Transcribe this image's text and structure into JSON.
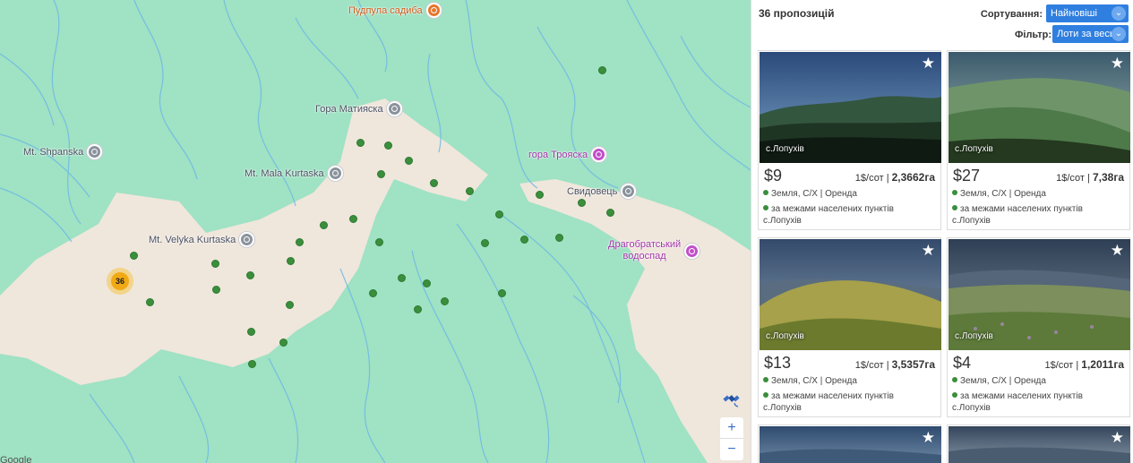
{
  "map": {
    "pois": [
      {
        "id": "pudpula",
        "label": "Пудпула садиба",
        "kind": "restaurant"
      },
      {
        "id": "matyaska",
        "label": "Гора Матияска",
        "kind": "peak"
      },
      {
        "id": "shpanska",
        "label": "Mt. Shpanska",
        "kind": "peak"
      },
      {
        "id": "mala",
        "label": "Mt. Mala Kurtaska",
        "kind": "peak"
      },
      {
        "id": "troyaska",
        "label": "гора Трояска",
        "kind": "attraction"
      },
      {
        "id": "svydovets",
        "label": "Свидовець",
        "kind": "peak"
      },
      {
        "id": "velyka",
        "label": "Mt. Velyka Kurtaska",
        "kind": "peak"
      },
      {
        "id": "vodospad_1",
        "label": "Драгобратський",
        "kind": "attraction"
      },
      {
        "id": "vodospad_2",
        "label": "водоспад",
        "kind": "attraction"
      }
    ],
    "cluster_count": "36",
    "zoom_in": "+",
    "zoom_out": "−",
    "attribution": "Google"
  },
  "panel": {
    "count_label": "36 пропозицій",
    "sort_label": "Сортування:",
    "sort_value": "Найновіші",
    "filter_label": "Фільтр:",
    "filter_value": "Лоти за весь час",
    "cards": [
      {
        "village": "с.Лопухів",
        "price": "$9",
        "per_sot": "1$/сот",
        "area": "2,3662га",
        "type": "Земля, С/Х | Оренда",
        "location": "за межами населених пунктів",
        "village2": "с.Лопухів"
      },
      {
        "village": "с.Лопухів",
        "price": "$27",
        "per_sot": "1$/сот",
        "area": "7,38га",
        "type": "Земля, С/Х | Оренда",
        "location": "за межами населених пунктів",
        "village2": "с.Лопухів"
      },
      {
        "village": "с.Лопухів",
        "price": "$13",
        "per_sot": "1$/сот",
        "area": "3,5357га",
        "type": "Земля, С/Х | Оренда",
        "location": "за межами населених пунктів",
        "village2": "с.Лопухів"
      },
      {
        "village": "с.Лопухів",
        "price": "$4",
        "per_sot": "1$/сот",
        "area": "1,2011га",
        "type": "Земля, С/Х | Оренда",
        "location": "за межами населених пунктів",
        "village2": "с.Лопухів"
      }
    ]
  },
  "colors": {
    "map_green": "#9fe2c4",
    "terrain": "#efe6dc",
    "river": "#6fb8e4",
    "marker": "#3a8e3c",
    "accent_blue": "#2f7fe0",
    "cluster": "#f1a915"
  }
}
